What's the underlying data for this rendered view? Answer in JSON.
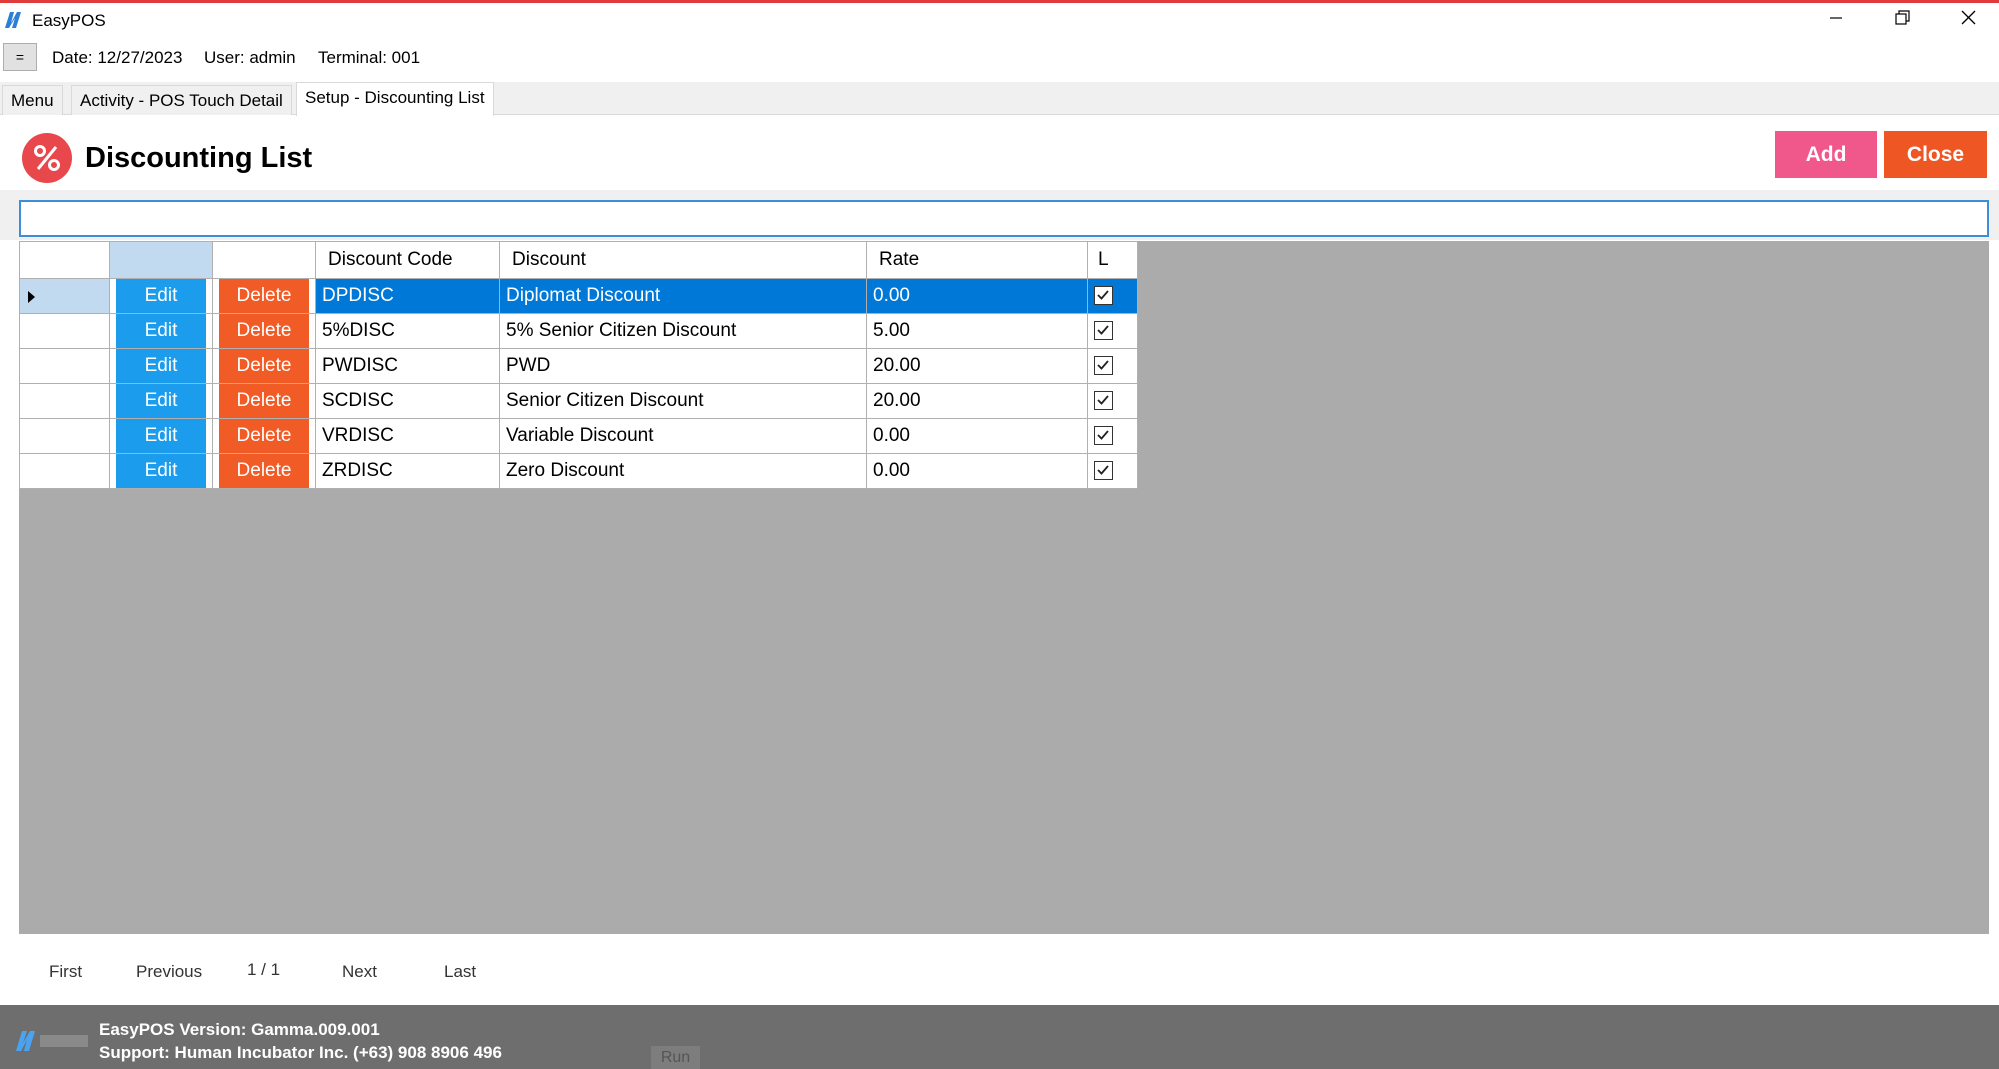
{
  "window": {
    "title": "EasyPOS",
    "app_icon": "easypos-logo-icon",
    "controls": [
      "minimize-icon",
      "restore-icon",
      "close-icon"
    ],
    "accent_color": "#e03a3a"
  },
  "infobar": {
    "menu_toggle_label": "=",
    "date": "Date: 12/27/2023",
    "user": "User: admin",
    "terminal": "Terminal: 001"
  },
  "tabs": [
    {
      "label": "Menu",
      "active": false
    },
    {
      "label": "Activity - POS Touch Detail",
      "active": false
    },
    {
      "label": "Setup - Discounting List",
      "active": true
    }
  ],
  "header": {
    "title": "Discounting List",
    "icon": "percent-icon",
    "add_label": "Add",
    "close_label": "Close",
    "add_color": "#f0578b",
    "close_color": "#ee5724"
  },
  "search": {
    "value": "",
    "placeholder": ""
  },
  "grid": {
    "columns": [
      "",
      "",
      "",
      "Discount Code",
      "Discount",
      "Rate",
      "L"
    ],
    "edit_label": "Edit",
    "delete_label": "Delete",
    "selected_color": "#0078d7",
    "rows": [
      {
        "code": "DPDISC",
        "discount": "Diplomat Discount",
        "rate": "0.00",
        "locked": true,
        "selected": true
      },
      {
        "code": "5%DISC",
        "discount": "5% Senior Citizen Discount",
        "rate": "5.00",
        "locked": true,
        "selected": false
      },
      {
        "code": "PWDISC",
        "discount": "PWD",
        "rate": "20.00",
        "locked": true,
        "selected": false
      },
      {
        "code": "SCDISC",
        "discount": "Senior Citizen Discount",
        "rate": "20.00",
        "locked": true,
        "selected": false
      },
      {
        "code": "VRDISC",
        "discount": "Variable Discount",
        "rate": "0.00",
        "locked": true,
        "selected": false
      },
      {
        "code": "ZRDISC",
        "discount": "Zero Discount",
        "rate": "0.00",
        "locked": true,
        "selected": false
      }
    ]
  },
  "pager": {
    "first": "First",
    "previous": "Previous",
    "page": "1 / 1",
    "next": "Next",
    "last": "Last"
  },
  "footer": {
    "logo": "human-incubator-logo-icon",
    "version": "EasyPOS Version: Gamma.009.001",
    "support": "Support: Human Incubator Inc. (+63) 908 8906 496",
    "run_label": "Run"
  }
}
